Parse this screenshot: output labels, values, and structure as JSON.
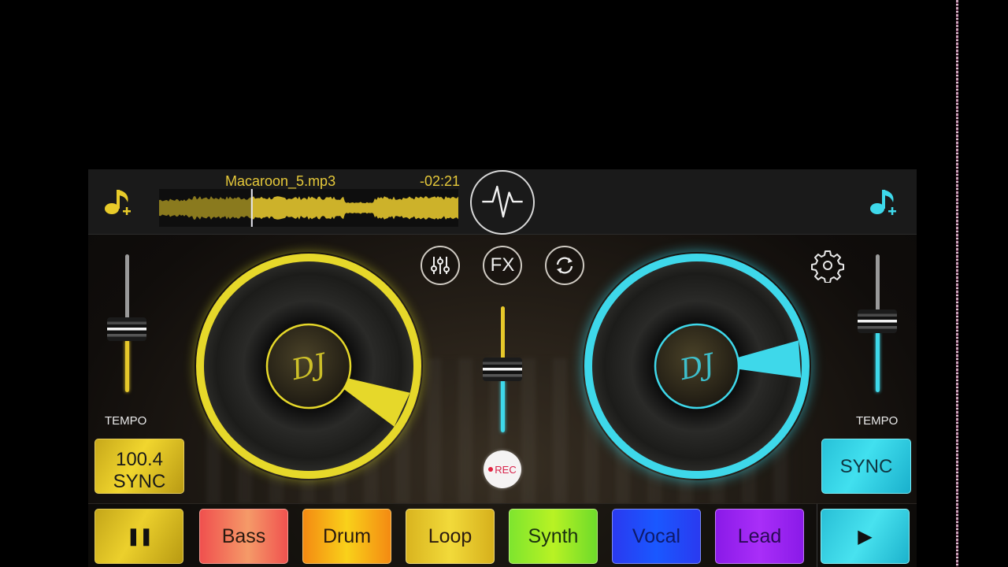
{
  "app": {
    "deck_a": {
      "add_track_icon": "music-note-plus-icon",
      "track_name": "Macaroon_5.mp3",
      "time_remaining": "-02:21",
      "playhead_fraction": 0.31,
      "tempo_label": "TEMPO",
      "tempo_fraction": 0.45,
      "bpm": "100.4",
      "sync_label": "SYNC",
      "accent": "#e6d82a"
    },
    "deck_b": {
      "add_track_icon": "music-note-plus-icon",
      "tempo_label": "TEMPO",
      "tempo_fraction": 0.52,
      "sync_label": "SYNC",
      "accent": "#3ed8ea"
    },
    "center": {
      "waveform_icon": "pulse-icon",
      "mixer_icon": "sliders-icon",
      "fx_label": "FX",
      "loop_icon": "refresh-icon",
      "settings_icon": "gear-icon",
      "crossfader_fraction": 0.5,
      "rec_label": "REC"
    },
    "deck_label": "DJ",
    "pads": [
      {
        "id": "pause",
        "label": "❚❚",
        "icon": "pause-icon"
      },
      {
        "id": "bass",
        "label": "Bass"
      },
      {
        "id": "drum",
        "label": "Drum"
      },
      {
        "id": "loop",
        "label": "Loop"
      },
      {
        "id": "synth",
        "label": "Synth"
      },
      {
        "id": "vocal",
        "label": "Vocal"
      },
      {
        "id": "lead",
        "label": "Lead"
      },
      {
        "id": "play",
        "label": "▶",
        "icon": "play-icon"
      }
    ]
  }
}
